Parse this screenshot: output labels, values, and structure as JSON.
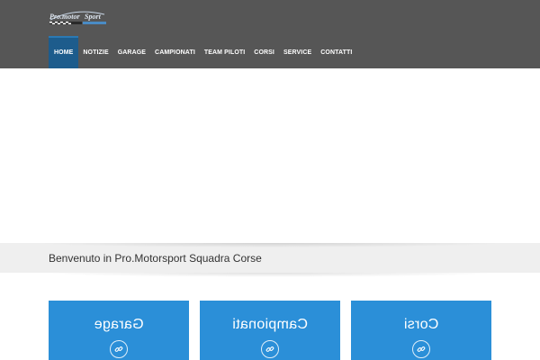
{
  "brand": {
    "logo_text": "Pro.motor Sport",
    "accent": "#1d5c8c",
    "card_color": "#2b8fd8"
  },
  "nav": {
    "items": [
      {
        "label": "HOME",
        "active": true
      },
      {
        "label": "NOTIZIE"
      },
      {
        "label": "GARAGE"
      },
      {
        "label": "CAMPIONATI"
      },
      {
        "label": "TEAM PILOTI"
      },
      {
        "label": "CORSI"
      },
      {
        "label": "SERVICE"
      },
      {
        "label": "CONTATTI"
      }
    ]
  },
  "welcome": {
    "title": "Benvenuto in Pro.Motorsport Squadra Corse"
  },
  "cards": [
    {
      "title": "Garage",
      "icon": "link-icon"
    },
    {
      "title": "Campionati",
      "icon": "link-icon"
    },
    {
      "title": "Corsi",
      "icon": "link-icon"
    }
  ]
}
